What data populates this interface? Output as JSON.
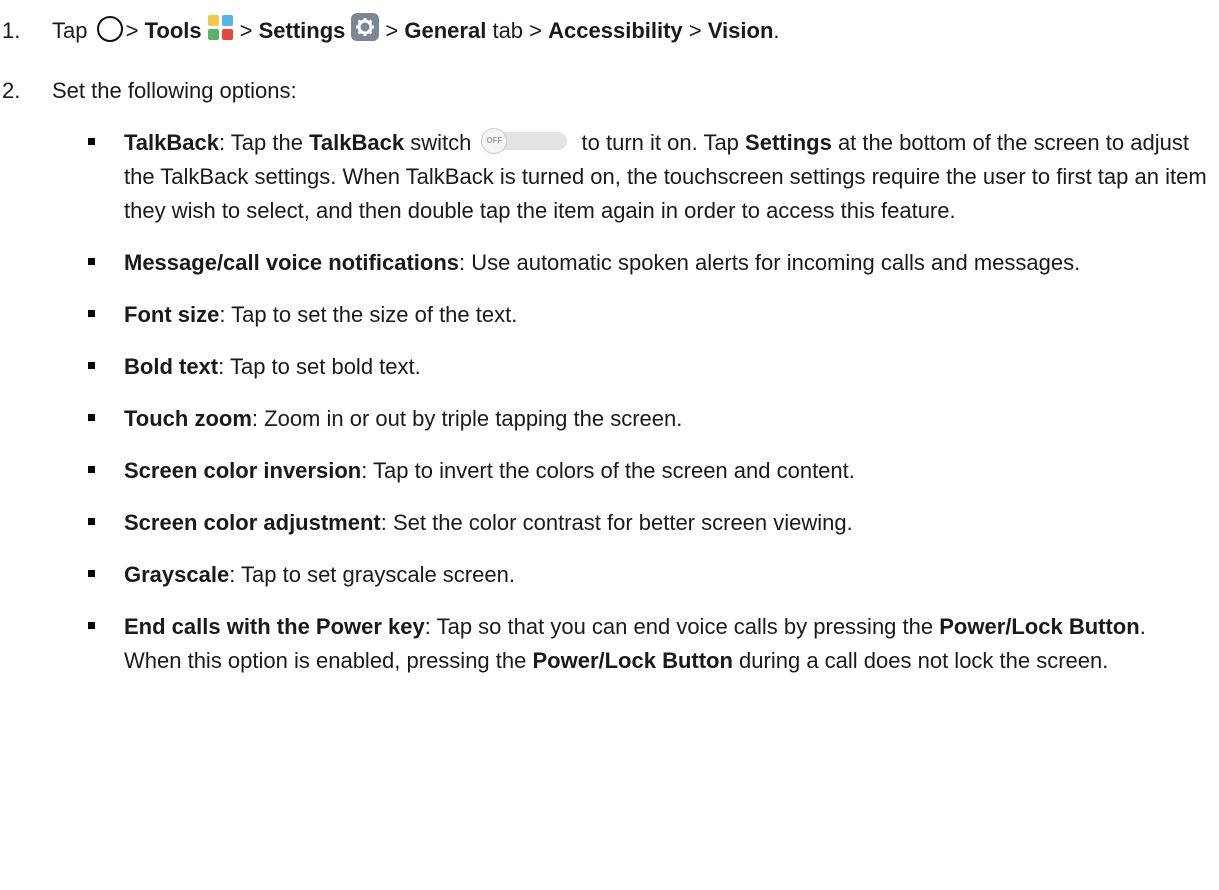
{
  "step1": {
    "number": "1.",
    "tap": "Tap",
    "sep": ">",
    "tools": "Tools",
    "settings": "Settings",
    "general": "General",
    "tab": "tab",
    "accessibility": "Accessibility",
    "vision": "Vision",
    "period": "."
  },
  "step2": {
    "number": "2.",
    "text": "Set the following options:"
  },
  "icons": {
    "home": "home-circle-icon",
    "tools": "tools-folder-icon",
    "settings": "settings-gear-icon",
    "switch": "off-switch-icon",
    "switch_label": "OFF"
  },
  "options": {
    "talkback": {
      "term": "TalkBack",
      "a": ": Tap the ",
      "b": "TalkBack",
      "c": " switch ",
      "d": " to turn it on. Tap ",
      "e": "Settings",
      "f": " at the bottom of the screen to adjust the TalkBack settings. When TalkBack is turned on, the touchscreen settings require the user to first tap an item they wish to select, and then double tap the item again in order to access this feature."
    },
    "message": {
      "term": "Message/call voice notifications",
      "desc": ": Use automatic spoken alerts for incoming calls and messages."
    },
    "font_size": {
      "term": "Font size",
      "desc": ": Tap to set the size of the text."
    },
    "bold_text": {
      "term": "Bold text",
      "desc": ": Tap to set bold text."
    },
    "touch_zoom": {
      "term": "Touch zoom",
      "desc": ": Zoom in or out by triple tapping the screen."
    },
    "inversion": {
      "term": "Screen color inversion",
      "desc": ": Tap to invert the colors of the screen and content."
    },
    "adjustment": {
      "term": "Screen color adjustment",
      "desc": ": Set the color contrast for better screen viewing."
    },
    "grayscale": {
      "term": "Grayscale",
      "desc": ": Tap to set grayscale screen."
    },
    "end_calls": {
      "term": "End calls with the Power key",
      "a": ": Tap so that you can end voice calls by pressing the ",
      "b": "Power/Lock Button",
      "c": ". When this option is enabled, pressing the ",
      "d": "Power/Lock Button",
      "e": " during a call does not lock the screen."
    }
  }
}
